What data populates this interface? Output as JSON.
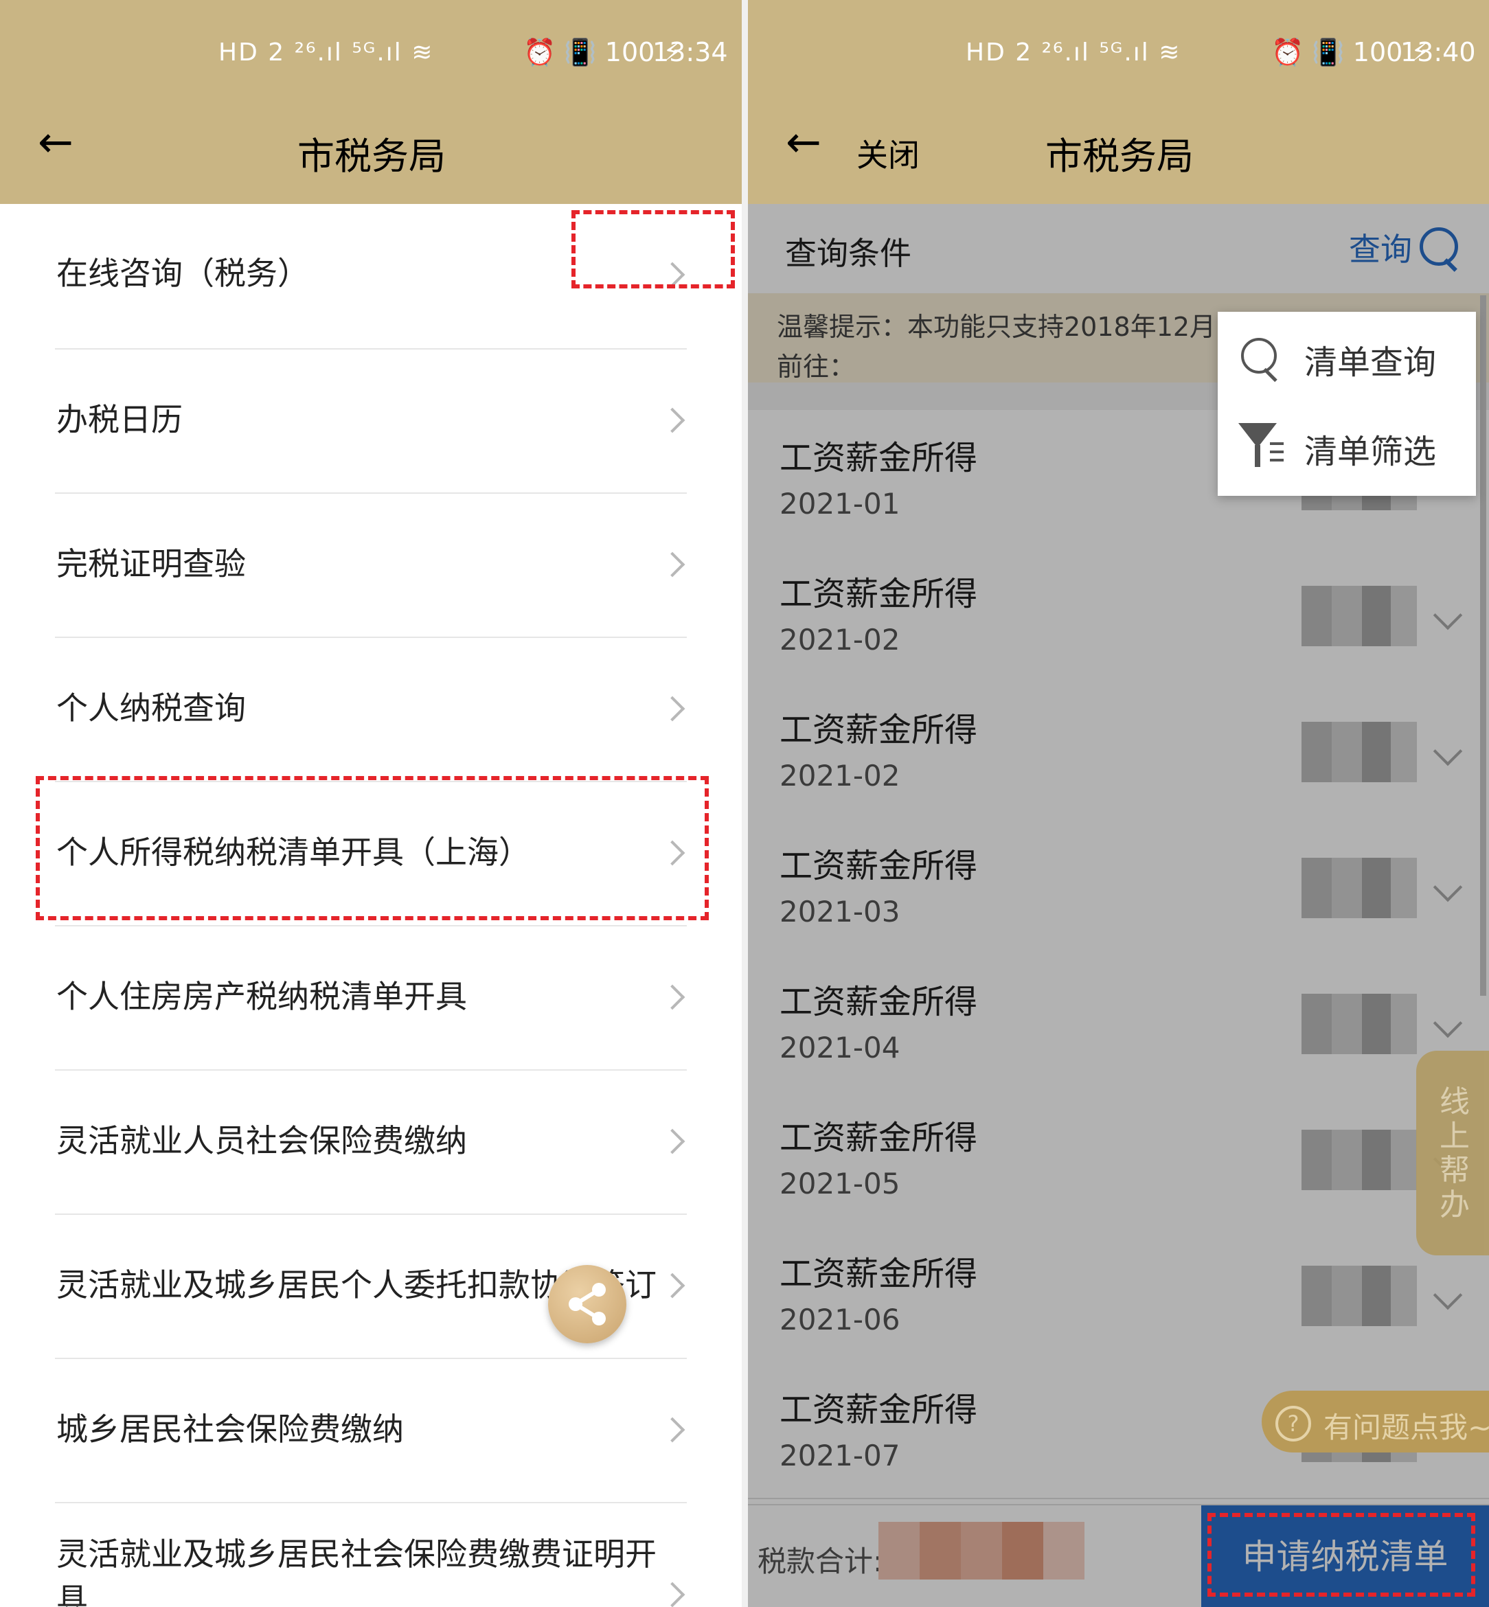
{
  "left": {
    "status": {
      "signal_icons": "HD 2 ²⁶.ıl ⁵ᴳ.ıl ≋",
      "right_icons": "⏰ 📳 100 ⚡",
      "time": "13:34"
    },
    "title": "市税务局",
    "menu_items": [
      {
        "label": "在线咨询（税务）"
      },
      {
        "label": "办税日历"
      },
      {
        "label": "完税证明查验"
      },
      {
        "label": "个人纳税查询"
      },
      {
        "label": "个人所得税纳税清单开具（上海）"
      },
      {
        "label": "个人住房房产税纳税清单开具"
      },
      {
        "label": "灵活就业人员社会保险费缴纳"
      },
      {
        "label": "灵活就业及城乡居民个人委托扣款协议签订"
      },
      {
        "label": "城乡居民社会保险费缴纳"
      },
      {
        "label_line1": "灵活就业及城乡居民社会保险费缴费证明开",
        "label_line2": "具"
      }
    ]
  },
  "right": {
    "status": {
      "signal_icons": "HD 2 ²⁶.ıl ⁵ᴳ.ıl ≋",
      "right_icons": "⏰ 📳 100 ⚡",
      "time": "13:40"
    },
    "close_label": "关闭",
    "title": "市税务局",
    "query_label": "查询条件",
    "query_button": "查询",
    "tip_line1": "温馨提示：本功能只支持2018年12月",
    "tip_line2": "前往：",
    "popup": {
      "item1": "清单查询",
      "item2": "清单筛选"
    },
    "records": [
      {
        "title": "工资薪金所得",
        "date": "2021-01"
      },
      {
        "title": "工资薪金所得",
        "date": "2021-02"
      },
      {
        "title": "工资薪金所得",
        "date": "2021-02"
      },
      {
        "title": "工资薪金所得",
        "date": "2021-03"
      },
      {
        "title": "工资薪金所得",
        "date": "2021-04"
      },
      {
        "title": "工资薪金所得",
        "date": "2021-05"
      },
      {
        "title": "工资薪金所得",
        "date": "2021-06"
      },
      {
        "title": "工资薪金所得",
        "date": "2021-07"
      }
    ],
    "help_tab": "线上帮办",
    "ask_icon": "?",
    "ask_text": "有问题点我~",
    "footer_label": "税款合计:",
    "apply_button": "申请纳税清单"
  },
  "colors": {
    "header": "#c9b584",
    "accent_blue": "#2a6fc9",
    "highlight_red": "#e5242a"
  }
}
